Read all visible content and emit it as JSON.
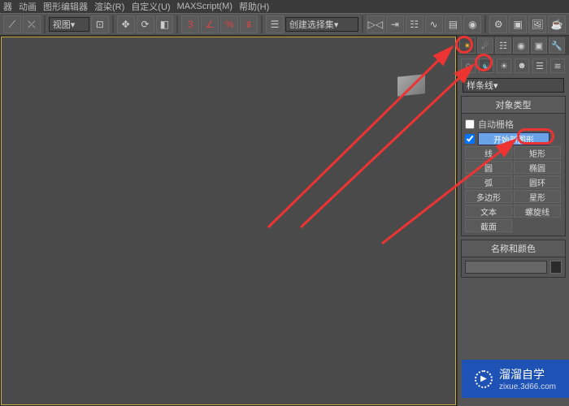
{
  "menu": [
    "器",
    "动画",
    "图形编辑器",
    "渲染(R)",
    "自定义(U)",
    "MAXScript(M)",
    "帮助(H)"
  ],
  "toolbar": {
    "viewLabel": "视图",
    "selSetLabel": "创建选择集",
    "threeX": "3"
  },
  "panel": {
    "dropdown": "样条线",
    "objTypeHeader": "对象类型",
    "autoGrid": "自动栅格",
    "startNewShape": "开始新图形",
    "shapes": [
      "线",
      "矩形",
      "圆",
      "椭圆",
      "弧",
      "圆环",
      "多边形",
      "星形",
      "文本",
      "螺旋线",
      "截面"
    ],
    "nameColorHeader": "名称和颜色"
  },
  "watermark": {
    "brand": "溜溜自学",
    "url": "zixue.3d66.com"
  },
  "colors": {
    "accent": "#6aa2e8",
    "anno": "#e33",
    "wm": "#1f52b5"
  }
}
